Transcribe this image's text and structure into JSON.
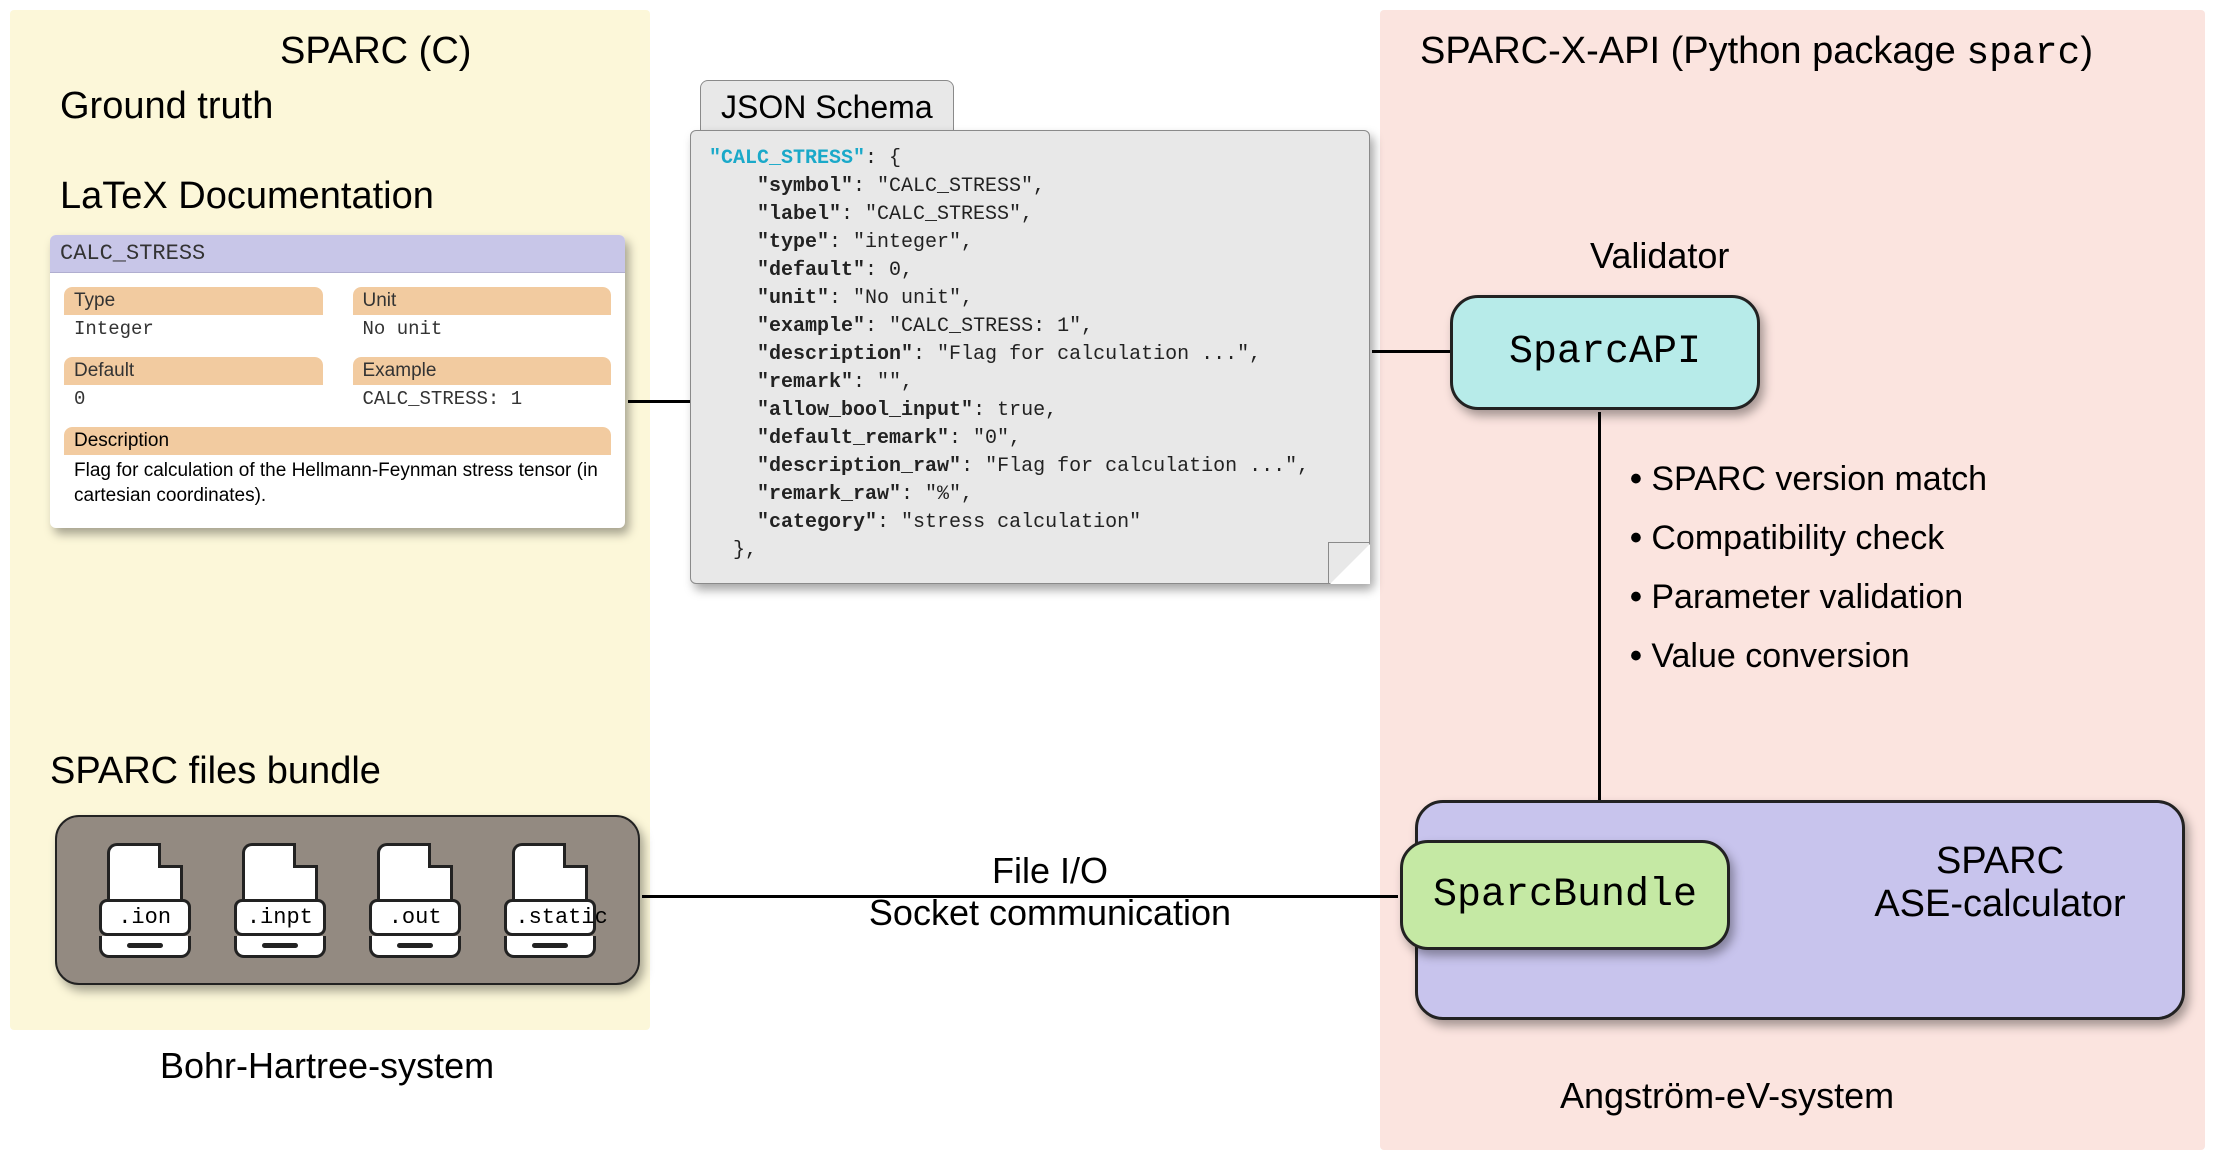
{
  "left_panel": {
    "title": "SPARC (C)",
    "ground_truth": "Ground truth",
    "latex_heading": "LaTeX Documentation",
    "latex_card": {
      "header": "CALC_STRESS",
      "type_label": "Type",
      "type_value": "Integer",
      "unit_label": "Unit",
      "unit_value": "No unit",
      "default_label": "Default",
      "default_value": "0",
      "example_label": "Example",
      "example_value": "CALC_STRESS: 1",
      "desc_label": "Description",
      "desc_value": "Flag for calculation of the Hellmann-Feynman stress tensor (in cartesian coordinates)."
    },
    "bundle_heading": "SPARC files bundle",
    "files": [
      ".ion",
      ".inpt",
      ".out",
      ".static"
    ],
    "bottom_label": "Bohr-Hartree-system"
  },
  "json_schema": {
    "tab": "JSON Schema",
    "lines": [
      {
        "pre": "",
        "key": "\"CALC_STRESS\"",
        "cls": "calc",
        "val": ": {"
      },
      {
        "pre": "    ",
        "key": "\"symbol\"",
        "cls": "bold",
        "val": ": \"CALC_STRESS\","
      },
      {
        "pre": "    ",
        "key": "\"label\"",
        "cls": "bold",
        "val": ": \"CALC_STRESS\","
      },
      {
        "pre": "    ",
        "key": "\"type\"",
        "cls": "bold",
        "val": ": \"integer\","
      },
      {
        "pre": "    ",
        "key": "\"default\"",
        "cls": "bold",
        "val": ": 0,"
      },
      {
        "pre": "    ",
        "key": "\"unit\"",
        "cls": "bold",
        "val": ": \"No unit\","
      },
      {
        "pre": "    ",
        "key": "\"example\"",
        "cls": "bold",
        "val": ": \"CALC_STRESS: 1\","
      },
      {
        "pre": "    ",
        "key": "\"description\"",
        "cls": "bold",
        "val": ": \"Flag for calculation ...\","
      },
      {
        "pre": "    ",
        "key": "\"remark\"",
        "cls": "bold",
        "val": ": \"\","
      },
      {
        "pre": "    ",
        "key": "\"allow_bool_input\"",
        "cls": "bold",
        "val": ": true,"
      },
      {
        "pre": "    ",
        "key": "\"default_remark\"",
        "cls": "bold",
        "val": ": \"0\","
      },
      {
        "pre": "    ",
        "key": "\"description_raw\"",
        "cls": "bold",
        "val": ": \"Flag for calculation ...\","
      },
      {
        "pre": "    ",
        "key": "\"remark_raw\"",
        "cls": "bold",
        "val": ": \"%\","
      },
      {
        "pre": "    ",
        "key": "\"category\"",
        "cls": "bold",
        "val": ": \"stress calculation\""
      },
      {
        "pre": "  ",
        "key": "",
        "cls": "",
        "val": "},"
      }
    ]
  },
  "io_label_1": "File I/O",
  "io_label_2": "Socket communication",
  "right_panel": {
    "title_plain": "SPARC-X-API (Python  package ",
    "title_mono": "sparc",
    "title_close": ")",
    "validator": "Validator",
    "api_box": "SparcAPI",
    "bullets": [
      "SPARC version match",
      "Compatibility check",
      "Parameter validation",
      "Value conversion"
    ],
    "bundle_pill": "SparcBundle",
    "calc_line1": "SPARC",
    "calc_line2": "ASE-calculator",
    "bottom_label": "Angström-eV-system"
  }
}
